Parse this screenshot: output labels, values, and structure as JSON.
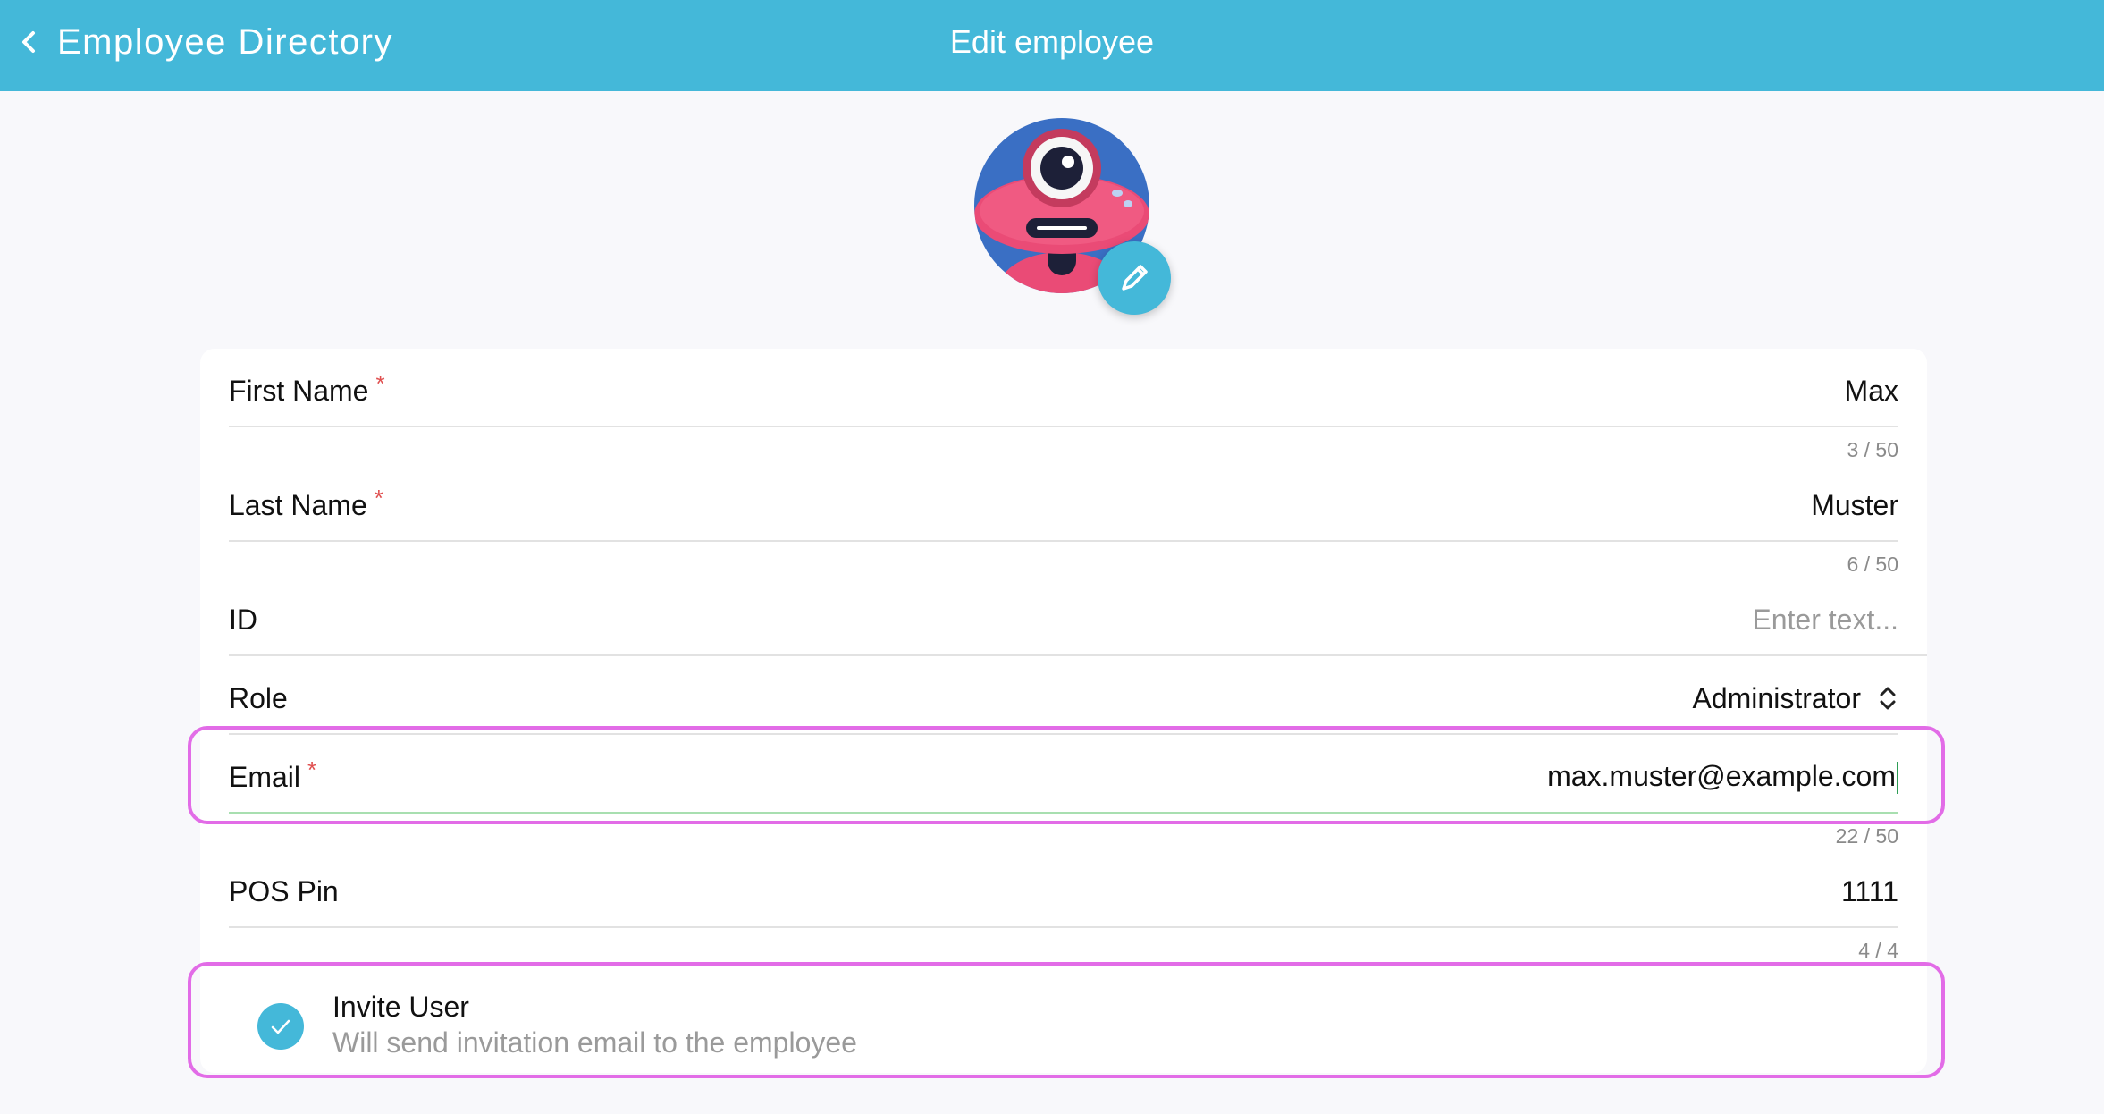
{
  "header": {
    "back_label": "Employee Directory",
    "title": "Edit employee",
    "color": "#44b8d9"
  },
  "avatar": {
    "icon": "robot-avatar-icon",
    "edit_icon": "pencil-icon"
  },
  "form": {
    "first_name": {
      "label": "First Name",
      "required": "*",
      "value": "Max",
      "counter": "3 / 50"
    },
    "last_name": {
      "label": "Last Name",
      "required": "*",
      "value": "Muster",
      "counter": "6 / 50"
    },
    "id": {
      "label": "ID",
      "placeholder": "Enter text..."
    },
    "role": {
      "label": "Role",
      "value": "Administrator",
      "icon": "up-down-chevron-icon"
    },
    "email": {
      "label": "Email",
      "required": "*",
      "value": "max.muster@example.com",
      "counter": "22 / 50"
    },
    "pos_pin": {
      "label": "POS Pin",
      "value": "1111",
      "counter": "4 / 4"
    }
  },
  "invite": {
    "title": "Invite User",
    "subtitle": "Will send invitation email to the employee",
    "checked": true,
    "icon": "check-icon"
  },
  "colors": {
    "accent": "#44b8d9",
    "required": "#e05050",
    "highlight": "#e26ce7",
    "focus_line": "#a8dfb0"
  }
}
